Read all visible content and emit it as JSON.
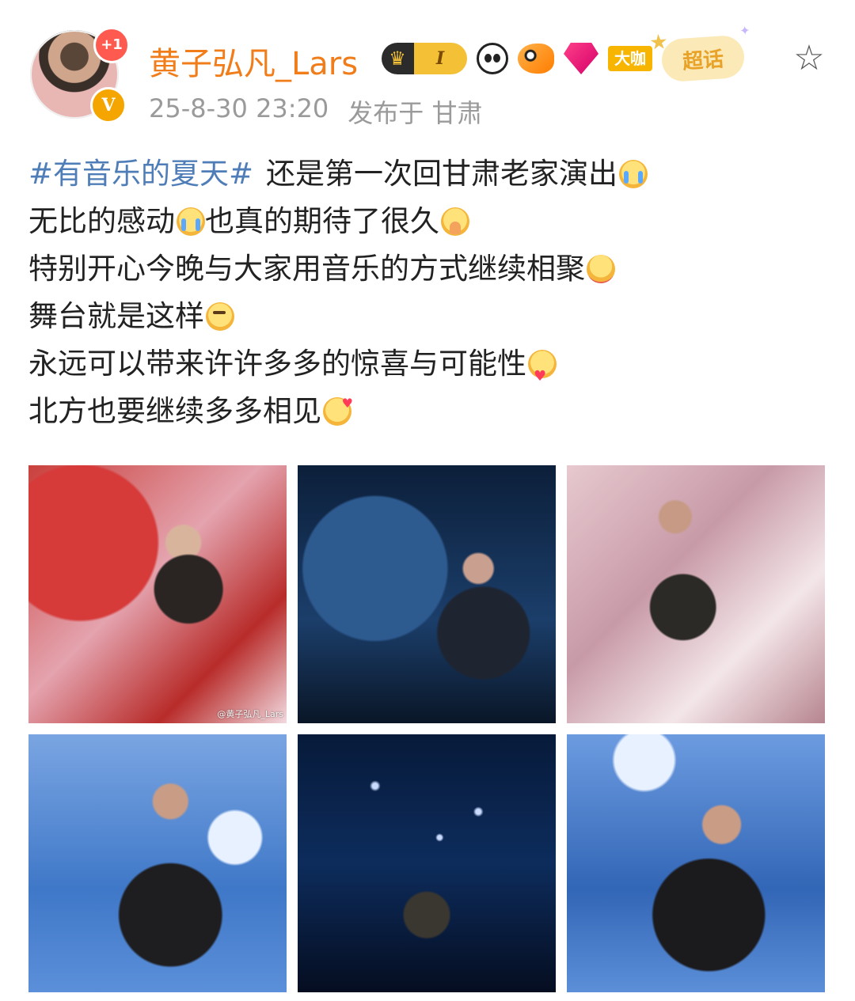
{
  "header": {
    "username": "黄子弘凡_Lars",
    "follow_plus": "+1",
    "verified_mark": "V",
    "level_badge": "I",
    "daka_badge": "大咖",
    "chaohua_badge": "超话",
    "timestamp": "25-8-30 23:20",
    "location": "发布于 甘肃",
    "icons": [
      "crown-icon",
      "panda-icon",
      "fish-icon",
      "gem-icon",
      "star-icon"
    ],
    "colors": {
      "username": "#f07d1a",
      "hashtag": "#4f7db7",
      "meta": "#9a9a9a"
    }
  },
  "post": {
    "hashtag": "#有音乐的夏天#",
    "lines": [
      "还是第一次回甘肃老家演出",
      "无比的感动",
      "也真的期待了很久",
      "特别开心今晚与大家用音乐的方式继续相聚",
      "舞台就是这样",
      "永远可以带来许许多多的惊喜与可能性",
      "北方也要继续多多相见"
    ],
    "emojis": [
      "cry-emoji",
      "cry-emoji",
      "pray-emoji",
      "hug-emoji",
      "wink-emoji",
      "love-emoji",
      "heart-emoji"
    ]
  },
  "photos": {
    "count": 6,
    "watermark": "@黄子弘凡_Lars"
  }
}
